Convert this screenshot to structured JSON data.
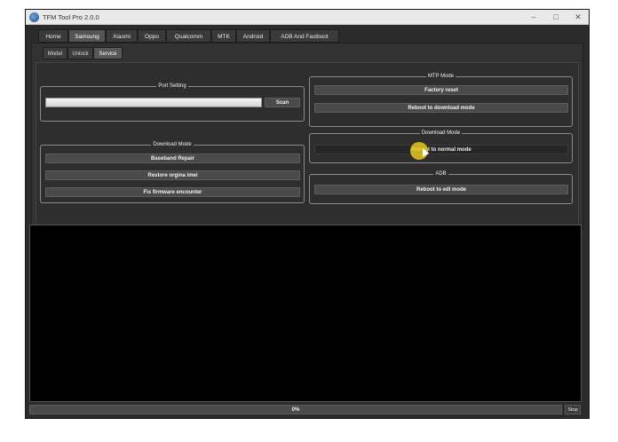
{
  "window": {
    "title": "TFM Tool Pro 2.0.0",
    "controls": {
      "minimize": "–",
      "maximize": "□",
      "close": "✕"
    }
  },
  "top_tabs": [
    "Home",
    "Samsung",
    "Xiaomi",
    "Oppo",
    "Qualcomm",
    "MTK",
    "Android",
    "ADB And Fastboot"
  ],
  "active_top_tab": "Samsung",
  "sub_tabs": [
    "Model",
    "Unlock",
    "Service"
  ],
  "active_sub_tab": "Service",
  "port_setting": {
    "title": "Port Setting",
    "scan_label": "Scan"
  },
  "download_mode_left": {
    "title": "Download Mode",
    "buttons": [
      "Baseband Repair",
      "Restore orgina imei",
      "Fix firmware encounter"
    ]
  },
  "mtp_mode": {
    "title": "MTP Mode",
    "buttons": [
      "Factory reset",
      "Reboot to download mode"
    ]
  },
  "download_mode_right": {
    "title": "Download Mode",
    "buttons": [
      "Reboot to normal mode"
    ]
  },
  "adb": {
    "title": "ADB",
    "buttons": [
      "Reboot to edl mode"
    ]
  },
  "status": {
    "progress_text": "0%",
    "progress": 0,
    "stop_label": "Stop"
  },
  "colors": {
    "highlight": "#e4c81e",
    "window_bg": "#2b2b2b"
  }
}
